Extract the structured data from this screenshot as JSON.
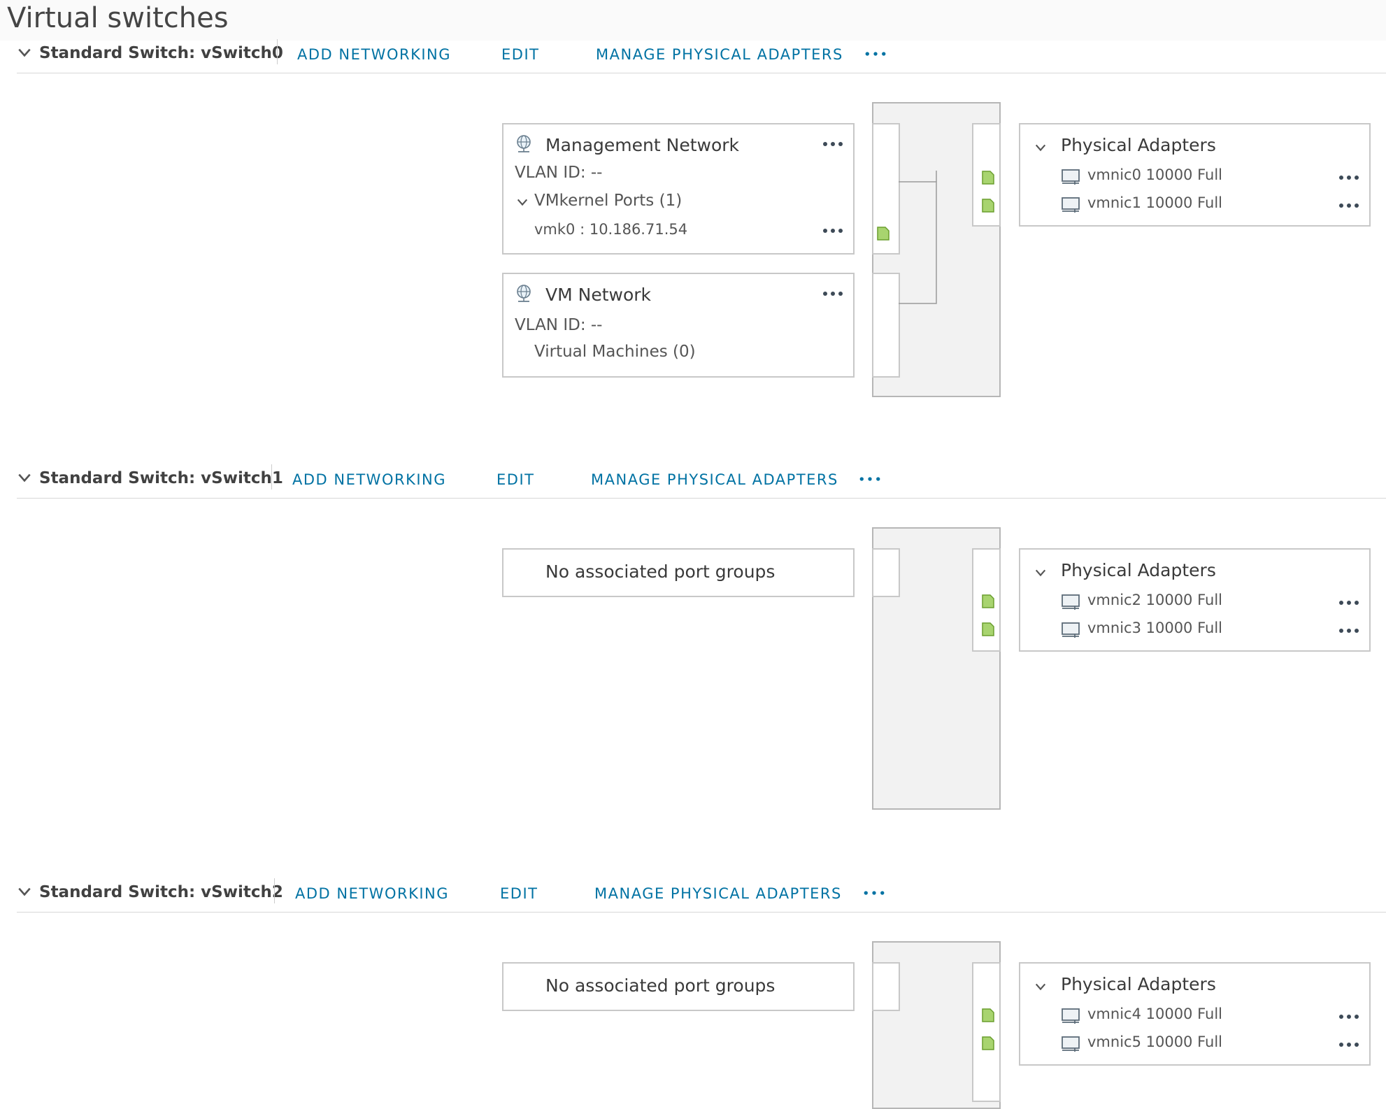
{
  "page": {
    "title": "Virtual switches"
  },
  "actions": {
    "add_networking": "ADD NETWORKING",
    "edit": "EDIT",
    "manage_adapters": "MANAGE PHYSICAL ADAPTERS",
    "more": "..."
  },
  "switches": [
    {
      "title": "Standard Switch: vSwitch0",
      "port_groups": [
        {
          "name": "Management Network",
          "vlan": "VLAN ID: --",
          "ports_label": "VMkernel Ports (1)",
          "vmk": "vmk0 : 10.186.71.54"
        },
        {
          "name": "VM Network",
          "vlan": "VLAN ID: --",
          "vms_label": "Virtual Machines (0)"
        }
      ],
      "physical_adapters": {
        "title": "Physical Adapters",
        "items": [
          "vmnic0 10000 Full",
          "vmnic1 10000 Full"
        ]
      }
    },
    {
      "title": "Standard Switch: vSwitch1",
      "no_port_groups": "No associated port groups",
      "physical_adapters": {
        "title": "Physical Adapters",
        "items": [
          "vmnic2 10000 Full",
          "vmnic3 10000 Full"
        ]
      }
    },
    {
      "title": "Standard Switch: vSwitch2",
      "no_port_groups": "No associated port groups",
      "physical_adapters": {
        "title": "Physical Adapters",
        "items": [
          "vmnic4 10000 Full",
          "vmnic5 10000 Full"
        ]
      }
    }
  ],
  "colors": {
    "link": "#0072a3",
    "port_green": "#a8d46f",
    "port_border": "#6a9e2f"
  }
}
